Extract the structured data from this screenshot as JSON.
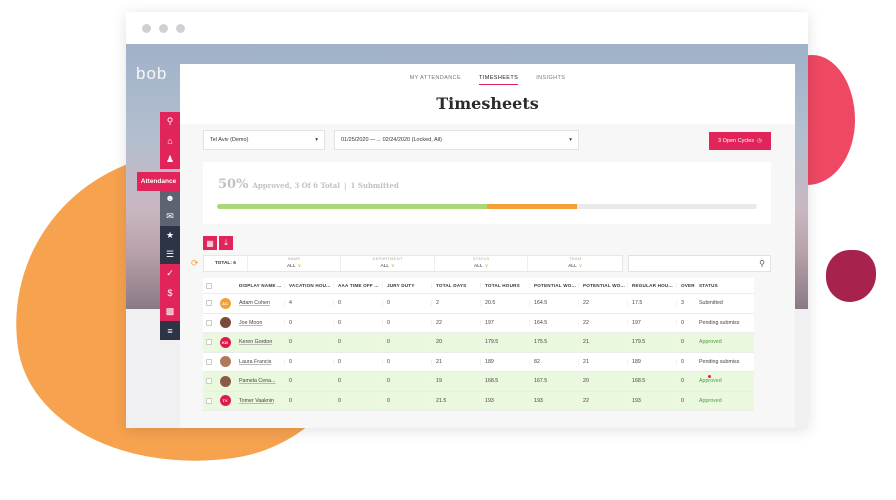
{
  "app": {
    "logo_text": "bob",
    "tabs": [
      {
        "label": "MY ATTENDANCE",
        "active": false
      },
      {
        "label": "TIMESHEETS",
        "active": true
      },
      {
        "label": "INSIGHTS",
        "active": false
      }
    ],
    "page_title": "Timesheets",
    "sidebar_active_label": "Attendance",
    "sidebar_icons": [
      "search-icon",
      "home-icon",
      "people-icon",
      "person-icon",
      "chat-icon",
      "badge-icon",
      "document-icon",
      "checklist-icon",
      "money-icon",
      "chart-icon",
      "settings-sliders-icon"
    ]
  },
  "filters": {
    "site": "Tel Aviv (Demo)",
    "cycle": "01/25/2020 —→ 02/24/2020 (Locked, All)",
    "open_cycles_label": "3 Open Cycles"
  },
  "summary": {
    "percent": "50%",
    "detail": "Approved, 3 Of 6 Total",
    "separator": "|",
    "submitted": "1 Submitted",
    "approved_fraction": 0.5,
    "submitted_fraction": 0.167
  },
  "filter_bar": {
    "total_label": "TOTAL: 6",
    "fields": [
      {
        "label": "NAME",
        "value": "ALL"
      },
      {
        "label": "DEPARTMENT",
        "value": "ALL"
      },
      {
        "label": "STATUS",
        "value": "ALL"
      },
      {
        "label": "TEAM",
        "value": "ALL"
      }
    ]
  },
  "table": {
    "headers": [
      "DISPLAY NAME ...",
      "VACATION HOU...",
      "AAA TIME OFF ...",
      "JURY DUTY",
      "TOTAL DAYS",
      "TOTAL HOURS",
      "POTENTIAL WO...",
      "POTENTIAL WO...",
      "REGULAR HOU...",
      "OVERT",
      "STATUS"
    ],
    "rows": [
      {
        "initials": "AC",
        "avatar_color": "#f3a037",
        "name": "Adam Cohen",
        "cells": [
          "4",
          "0",
          "0",
          "2",
          "20.5",
          "164.5",
          "22",
          "17.5",
          "3"
        ],
        "status": "Submitted",
        "approved": false
      },
      {
        "initials": "",
        "avatar_color": "#7a4a3a",
        "name": "Joe Moon",
        "cells": [
          "0",
          "0",
          "0",
          "22",
          "197",
          "164.5",
          "22",
          "197",
          "0"
        ],
        "status": "Pending submiss",
        "approved": false
      },
      {
        "initials": "KG",
        "avatar_color": "#d81e4e",
        "name": "Keren Gordon",
        "cells": [
          "0",
          "0",
          "0",
          "20",
          "179.5",
          "175.5",
          "21",
          "179.5",
          "0"
        ],
        "status": "Approved",
        "approved": true
      },
      {
        "initials": "",
        "avatar_color": "#b07a58",
        "name": "Laura Francis",
        "cells": [
          "0",
          "0",
          "0",
          "21",
          "189",
          "82",
          "21",
          "189",
          "0"
        ],
        "status": "Pending submiss",
        "approved": false
      },
      {
        "initials": "",
        "avatar_color": "#8a5a48",
        "name": "Pamela Cena...",
        "cells": [
          "0",
          "0",
          "0",
          "19",
          "168.5",
          "167.5",
          "20",
          "168.5",
          "0"
        ],
        "status": "Approved",
        "approved": true
      },
      {
        "initials": "TV",
        "avatar_color": "#d81e4e",
        "name": "Tomer Vaaknin",
        "cells": [
          "0",
          "0",
          "0",
          "21.5",
          "193",
          "193",
          "22",
          "193",
          "0"
        ],
        "status": "Approved",
        "approved": true
      }
    ]
  }
}
